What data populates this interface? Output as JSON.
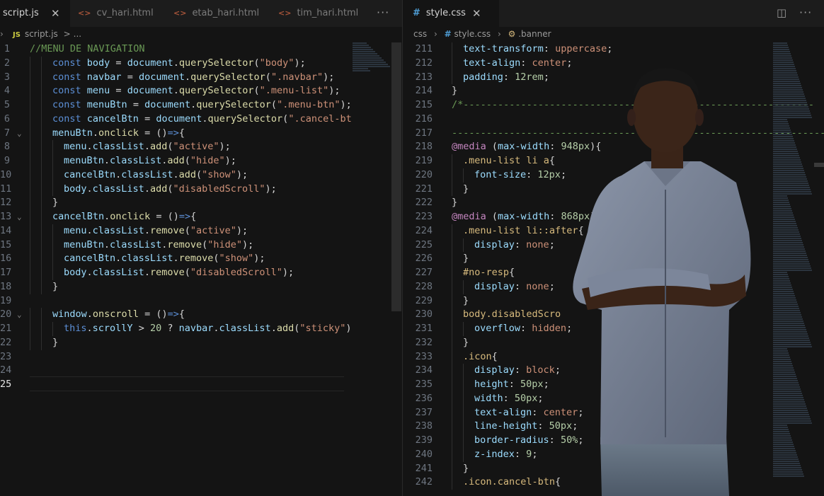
{
  "left_editor": {
    "tabs": [
      {
        "label": "script.js",
        "icon": "js-file-icon",
        "active": true
      },
      {
        "label": "cv_hari.html",
        "icon": "html-file-icon",
        "active": false
      },
      {
        "label": "etab_hari.html",
        "icon": "html-file-icon",
        "active": false
      },
      {
        "label": "tim_hari.html",
        "icon": "html-file-icon",
        "active": false
      }
    ],
    "breadcrumb": {
      "lang": "JS",
      "file": "script.js",
      "sep": ">",
      "rest": "..."
    },
    "lines": [
      {
        "num": "1",
        "tokens": [
          [
            "c",
            "//MENU DE NAVIGATION"
          ]
        ]
      },
      {
        "num": "2",
        "tokens": [
          [
            "k",
            "const "
          ],
          [
            "v",
            "body"
          ],
          [
            "p",
            " = "
          ],
          [
            "v",
            "document"
          ],
          [
            "p",
            "."
          ],
          [
            "f",
            "querySelector"
          ],
          [
            "p",
            "("
          ],
          [
            "s",
            "\"body\""
          ],
          [
            "p",
            ");"
          ]
        ]
      },
      {
        "num": "3",
        "tokens": [
          [
            "k",
            "const "
          ],
          [
            "v",
            "navbar"
          ],
          [
            "p",
            " = "
          ],
          [
            "v",
            "document"
          ],
          [
            "p",
            "."
          ],
          [
            "f",
            "querySelector"
          ],
          [
            "p",
            "("
          ],
          [
            "s",
            "\".navbar\""
          ],
          [
            "p",
            ");"
          ]
        ]
      },
      {
        "num": "4",
        "tokens": [
          [
            "k",
            "const "
          ],
          [
            "v",
            "menu"
          ],
          [
            "p",
            " = "
          ],
          [
            "v",
            "document"
          ],
          [
            "p",
            "."
          ],
          [
            "f",
            "querySelector"
          ],
          [
            "p",
            "("
          ],
          [
            "s",
            "\".menu-list\""
          ],
          [
            "p",
            ");"
          ]
        ]
      },
      {
        "num": "5",
        "tokens": [
          [
            "k",
            "const "
          ],
          [
            "v",
            "menuBtn"
          ],
          [
            "p",
            " = "
          ],
          [
            "v",
            "document"
          ],
          [
            "p",
            "."
          ],
          [
            "f",
            "querySelector"
          ],
          [
            "p",
            "("
          ],
          [
            "s",
            "\".menu-btn\""
          ],
          [
            "p",
            ");"
          ]
        ]
      },
      {
        "num": "6",
        "tokens": [
          [
            "k",
            "const "
          ],
          [
            "v",
            "cancelBtn"
          ],
          [
            "p",
            " = "
          ],
          [
            "v",
            "document"
          ],
          [
            "p",
            "."
          ],
          [
            "f",
            "querySelector"
          ],
          [
            "p",
            "("
          ],
          [
            "s",
            "\".cancel-bt"
          ]
        ]
      },
      {
        "num": "7",
        "tokens": [
          [
            "v",
            "menuBtn"
          ],
          [
            "p",
            "."
          ],
          [
            "f",
            "onclick"
          ],
          [
            "p",
            " = ()"
          ],
          [
            "k",
            "=>"
          ],
          [
            "p",
            "{"
          ]
        ]
      },
      {
        "num": "8",
        "tokens": [
          [
            "v",
            "menu"
          ],
          [
            "p",
            "."
          ],
          [
            "v",
            "classList"
          ],
          [
            "p",
            "."
          ],
          [
            "f",
            "add"
          ],
          [
            "p",
            "("
          ],
          [
            "s",
            "\"active\""
          ],
          [
            "p",
            ");"
          ]
        ]
      },
      {
        "num": "9",
        "tokens": [
          [
            "v",
            "menuBtn"
          ],
          [
            "p",
            "."
          ],
          [
            "v",
            "classList"
          ],
          [
            "p",
            "."
          ],
          [
            "f",
            "add"
          ],
          [
            "p",
            "("
          ],
          [
            "s",
            "\"hide\""
          ],
          [
            "p",
            ");"
          ]
        ]
      },
      {
        "num": "10",
        "tokens": [
          [
            "v",
            "cancelBtn"
          ],
          [
            "p",
            "."
          ],
          [
            "v",
            "classList"
          ],
          [
            "p",
            "."
          ],
          [
            "f",
            "add"
          ],
          [
            "p",
            "("
          ],
          [
            "s",
            "\"show\""
          ],
          [
            "p",
            ");"
          ]
        ]
      },
      {
        "num": "11",
        "tokens": [
          [
            "v",
            "body"
          ],
          [
            "p",
            "."
          ],
          [
            "v",
            "classList"
          ],
          [
            "p",
            "."
          ],
          [
            "f",
            "add"
          ],
          [
            "p",
            "("
          ],
          [
            "s",
            "\"disabledScroll\""
          ],
          [
            "p",
            ");"
          ]
        ]
      },
      {
        "num": "12",
        "tokens": [
          [
            "p",
            "}"
          ]
        ]
      },
      {
        "num": "13",
        "tokens": [
          [
            "v",
            "cancelBtn"
          ],
          [
            "p",
            "."
          ],
          [
            "f",
            "onclick"
          ],
          [
            "p",
            " = ()"
          ],
          [
            "k",
            "=>"
          ],
          [
            "p",
            "{"
          ]
        ]
      },
      {
        "num": "14",
        "tokens": [
          [
            "v",
            "menu"
          ],
          [
            "p",
            "."
          ],
          [
            "v",
            "classList"
          ],
          [
            "p",
            "."
          ],
          [
            "f",
            "remove"
          ],
          [
            "p",
            "("
          ],
          [
            "s",
            "\"active\""
          ],
          [
            "p",
            ");"
          ]
        ]
      },
      {
        "num": "15",
        "tokens": [
          [
            "v",
            "menuBtn"
          ],
          [
            "p",
            "."
          ],
          [
            "v",
            "classList"
          ],
          [
            "p",
            "."
          ],
          [
            "f",
            "remove"
          ],
          [
            "p",
            "("
          ],
          [
            "s",
            "\"hide\""
          ],
          [
            "p",
            ");"
          ]
        ]
      },
      {
        "num": "16",
        "tokens": [
          [
            "v",
            "cancelBtn"
          ],
          [
            "p",
            "."
          ],
          [
            "v",
            "classList"
          ],
          [
            "p",
            "."
          ],
          [
            "f",
            "remove"
          ],
          [
            "p",
            "("
          ],
          [
            "s",
            "\"show\""
          ],
          [
            "p",
            ");"
          ]
        ]
      },
      {
        "num": "17",
        "tokens": [
          [
            "v",
            "body"
          ],
          [
            "p",
            "."
          ],
          [
            "v",
            "classList"
          ],
          [
            "p",
            "."
          ],
          [
            "f",
            "remove"
          ],
          [
            "p",
            "("
          ],
          [
            "s",
            "\"disabledScroll\""
          ],
          [
            "p",
            ");"
          ]
        ]
      },
      {
        "num": "18",
        "tokens": [
          [
            "p",
            "}"
          ]
        ]
      },
      {
        "num": "19",
        "tokens": []
      },
      {
        "num": "20",
        "tokens": [
          [
            "v",
            "window"
          ],
          [
            "p",
            "."
          ],
          [
            "f",
            "onscroll"
          ],
          [
            "p",
            " = ()"
          ],
          [
            "k",
            "=>"
          ],
          [
            "p",
            "{"
          ]
        ]
      },
      {
        "num": "21",
        "tokens": [
          [
            "k",
            "this"
          ],
          [
            "p",
            "."
          ],
          [
            "v",
            "scrollY"
          ],
          [
            "p",
            " > "
          ],
          [
            "n",
            "20"
          ],
          [
            "p",
            " ? "
          ],
          [
            "v",
            "navbar"
          ],
          [
            "p",
            "."
          ],
          [
            "v",
            "classList"
          ],
          [
            "p",
            "."
          ],
          [
            "f",
            "add"
          ],
          [
            "p",
            "("
          ],
          [
            "s",
            "\"sticky\""
          ],
          [
            "p",
            ")"
          ]
        ]
      },
      {
        "num": "22",
        "tokens": [
          [
            "p",
            "}"
          ]
        ]
      },
      {
        "num": "23",
        "tokens": []
      },
      {
        "num": "24",
        "tokens": []
      },
      {
        "num": "25",
        "tokens": []
      }
    ]
  },
  "right_editor": {
    "tab": {
      "label": "style.css",
      "icon": "css-file-icon"
    },
    "breadcrumb": {
      "folder": "css",
      "file": "style.css",
      "symbol": ".banner"
    },
    "lines": [
      {
        "num": "211",
        "tokens": [
          [
            "prop",
            "text-transform"
          ],
          [
            "p",
            ": "
          ],
          [
            "val",
            "uppercase"
          ],
          [
            "p",
            ";"
          ]
        ]
      },
      {
        "num": "212",
        "tokens": [
          [
            "prop",
            "text-align"
          ],
          [
            "p",
            ": "
          ],
          [
            "val",
            "center"
          ],
          [
            "p",
            ";"
          ]
        ]
      },
      {
        "num": "213",
        "tokens": [
          [
            "prop",
            "padding"
          ],
          [
            "p",
            ": "
          ],
          [
            "n",
            "12rem"
          ],
          [
            "p",
            ";"
          ]
        ]
      },
      {
        "num": "214",
        "tokens": [
          [
            "p",
            "}"
          ]
        ]
      },
      {
        "num": "215",
        "tokens": [
          [
            "c",
            "/*-------------------------------------------------------------"
          ]
        ]
      },
      {
        "num": "216",
        "tokens": []
      },
      {
        "num": "217",
        "tokens": [
          [
            "c",
            "-----------------------------------------------------------------"
          ]
        ]
      },
      {
        "num": "218",
        "tokens": [
          [
            "at",
            "@media"
          ],
          [
            "p",
            " ("
          ],
          [
            "prop",
            "max-width"
          ],
          [
            "p",
            ": "
          ],
          [
            "n",
            "948px"
          ],
          [
            "p",
            "){"
          ]
        ]
      },
      {
        "num": "219",
        "tokens": [
          [
            "sel",
            ".menu-list li a"
          ],
          [
            "p",
            "{"
          ]
        ]
      },
      {
        "num": "220",
        "tokens": [
          [
            "prop",
            "font-size"
          ],
          [
            "p",
            ": "
          ],
          [
            "n",
            "12px"
          ],
          [
            "p",
            ";"
          ]
        ]
      },
      {
        "num": "221",
        "tokens": [
          [
            "p",
            "}"
          ]
        ]
      },
      {
        "num": "222",
        "tokens": [
          [
            "p",
            "}"
          ]
        ]
      },
      {
        "num": "223",
        "tokens": [
          [
            "at",
            "@media"
          ],
          [
            "p",
            " ("
          ],
          [
            "prop",
            "max-width"
          ],
          [
            "p",
            ": "
          ],
          [
            "n",
            "868px"
          ],
          [
            "p",
            ") {"
          ]
        ]
      },
      {
        "num": "224",
        "tokens": [
          [
            "sel",
            ".menu-list li::after"
          ],
          [
            "p",
            "{"
          ]
        ]
      },
      {
        "num": "225",
        "tokens": [
          [
            "prop",
            "display"
          ],
          [
            "p",
            ": "
          ],
          [
            "val",
            "none"
          ],
          [
            "p",
            ";"
          ]
        ]
      },
      {
        "num": "226",
        "tokens": [
          [
            "p",
            "}"
          ]
        ]
      },
      {
        "num": "227",
        "tokens": [
          [
            "sel",
            "#no-resp"
          ],
          [
            "p",
            "{"
          ]
        ]
      },
      {
        "num": "228",
        "tokens": [
          [
            "prop",
            "display"
          ],
          [
            "p",
            ": "
          ],
          [
            "val",
            "none"
          ],
          [
            "p",
            ";"
          ]
        ]
      },
      {
        "num": "229",
        "tokens": [
          [
            "p",
            "}"
          ]
        ]
      },
      {
        "num": "230",
        "tokens": [
          [
            "sel",
            "body.disabledScro"
          ]
        ]
      },
      {
        "num": "231",
        "tokens": [
          [
            "prop",
            "overflow"
          ],
          [
            "p",
            ": "
          ],
          [
            "val",
            "hidden"
          ],
          [
            "p",
            ";"
          ]
        ]
      },
      {
        "num": "232",
        "tokens": [
          [
            "p",
            "}"
          ]
        ]
      },
      {
        "num": "233",
        "tokens": [
          [
            "sel",
            ".icon"
          ],
          [
            "p",
            "{"
          ]
        ]
      },
      {
        "num": "234",
        "tokens": [
          [
            "prop",
            "display"
          ],
          [
            "p",
            ": "
          ],
          [
            "val",
            "block"
          ],
          [
            "p",
            ";"
          ]
        ]
      },
      {
        "num": "235",
        "tokens": [
          [
            "prop",
            "height"
          ],
          [
            "p",
            ": "
          ],
          [
            "n",
            "50px"
          ],
          [
            "p",
            ";"
          ]
        ]
      },
      {
        "num": "236",
        "tokens": [
          [
            "prop",
            "width"
          ],
          [
            "p",
            ": "
          ],
          [
            "n",
            "50px"
          ],
          [
            "p",
            ";"
          ]
        ]
      },
      {
        "num": "237",
        "tokens": [
          [
            "prop",
            "text-align"
          ],
          [
            "p",
            ": "
          ],
          [
            "val",
            "center"
          ],
          [
            "p",
            ";"
          ]
        ]
      },
      {
        "num": "238",
        "tokens": [
          [
            "prop",
            "line-height"
          ],
          [
            "p",
            ": "
          ],
          [
            "n",
            "50px"
          ],
          [
            "p",
            ";"
          ]
        ]
      },
      {
        "num": "239",
        "tokens": [
          [
            "prop",
            "border-radius"
          ],
          [
            "p",
            ": "
          ],
          [
            "n",
            "50%"
          ],
          [
            "p",
            ";"
          ]
        ]
      },
      {
        "num": "240",
        "tokens": [
          [
            "prop",
            "z-index"
          ],
          [
            "p",
            ": "
          ],
          [
            "n",
            "9"
          ],
          [
            "p",
            ";"
          ]
        ]
      },
      {
        "num": "241",
        "tokens": [
          [
            "p",
            "}"
          ]
        ]
      },
      {
        "num": "242",
        "tokens": [
          [
            "sel",
            ".icon.cancel-btn"
          ],
          [
            "p",
            "{"
          ]
        ]
      }
    ]
  },
  "colors": {
    "background": "#141414",
    "tabbar": "#1c1c1c",
    "accent_css": "#4f9ed6",
    "accent_js": "#cbcb41"
  },
  "overlay_image": "person-photo-icon"
}
